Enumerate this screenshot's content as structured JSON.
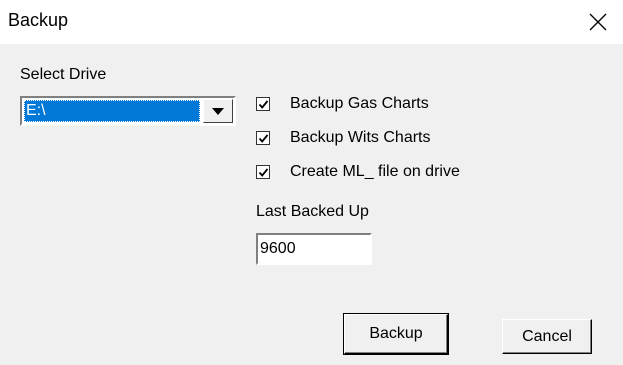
{
  "window": {
    "title": "Backup",
    "close_icon": "close-icon"
  },
  "drive": {
    "label": "Select Drive",
    "selected": "E:\\",
    "arrow_icon": "dropdown-arrow-icon"
  },
  "options": {
    "backup_gas_charts": {
      "label": "Backup Gas Charts",
      "checked": true
    },
    "backup_wits_charts": {
      "label": "Backup Wits Charts",
      "checked": true
    },
    "create_ml_file": {
      "label": "Create ML_ file on drive",
      "checked": true
    }
  },
  "last_backed_up": {
    "label": "Last Backed Up",
    "value": "9600"
  },
  "buttons": {
    "backup": "Backup",
    "cancel": "Cancel"
  },
  "colors": {
    "selection": "#0078d7",
    "face": "#f0f0f0",
    "title_bg": "#ffffff"
  }
}
